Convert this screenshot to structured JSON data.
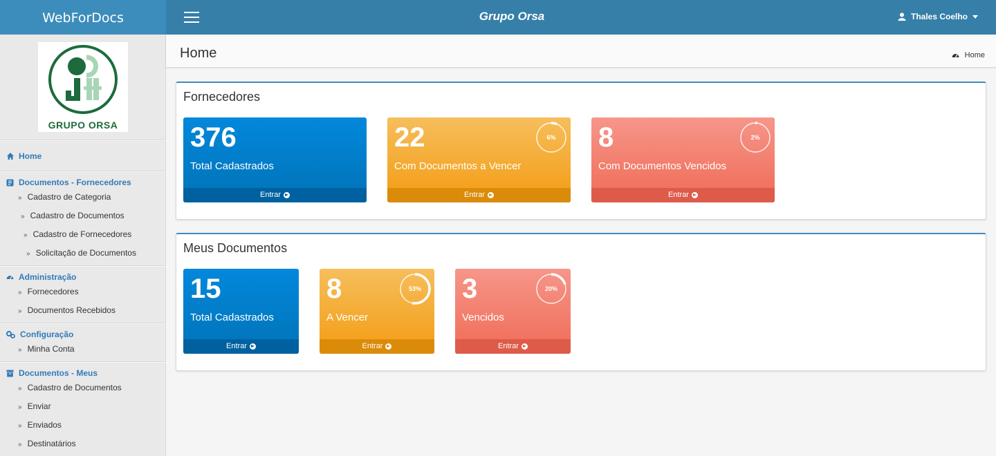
{
  "app": {
    "brand": "WebForDocs",
    "company": "Grupo Orsa",
    "user": "Thales Coelho"
  },
  "logo": {
    "text": "GRUPO ORSA"
  },
  "sidebar": {
    "home": "Home",
    "sections": [
      {
        "title": "Documentos - Fornecedores",
        "items": [
          "Cadastro de Categoria",
          "Cadastro de Documentos",
          "Cadastro de Fornecedores",
          "Solicitação de Documentos"
        ]
      },
      {
        "title": "Administração",
        "items": [
          "Fornecedores",
          "Documentos Recebidos"
        ]
      },
      {
        "title": "Configuração",
        "items": [
          "Minha Conta"
        ]
      },
      {
        "title": "Documentos - Meus",
        "items": [
          "Cadastro de Documentos",
          "Enviar",
          "Enviados",
          "Destinatários"
        ]
      }
    ]
  },
  "header": {
    "title": "Home",
    "breadcrumb": "Home"
  },
  "panels": [
    {
      "title": "Fornecedores",
      "cards": [
        {
          "value": "376",
          "label": "Total Cadastrados",
          "action": "Entrar",
          "color": "blue"
        },
        {
          "value": "22",
          "label": "Com Documentos a Vencer",
          "action": "Entrar",
          "color": "yellow",
          "percent": 6,
          "percent_text": "6%"
        },
        {
          "value": "8",
          "label": "Com Documentos Vencidos",
          "action": "Entrar",
          "color": "red",
          "percent": 2,
          "percent_text": "2%"
        }
      ]
    },
    {
      "title": "Meus Documentos",
      "cards": [
        {
          "value": "15",
          "label": "Total Cadastrados",
          "action": "Entrar",
          "color": "blue"
        },
        {
          "value": "8",
          "label": "A Vencer",
          "action": "Entrar",
          "color": "yellow",
          "percent": 53,
          "percent_text": "53%"
        },
        {
          "value": "3",
          "label": "Vencidos",
          "action": "Entrar",
          "color": "red",
          "percent": 20,
          "percent_text": "20%"
        }
      ]
    }
  ],
  "colors": {
    "primary": "#3c8dbc",
    "topbar": "#367fa9",
    "blue_card": "#0073b7",
    "yellow_card": "#f39c12",
    "red_card": "#f06b56",
    "logo_green": "#1d6b3c"
  }
}
